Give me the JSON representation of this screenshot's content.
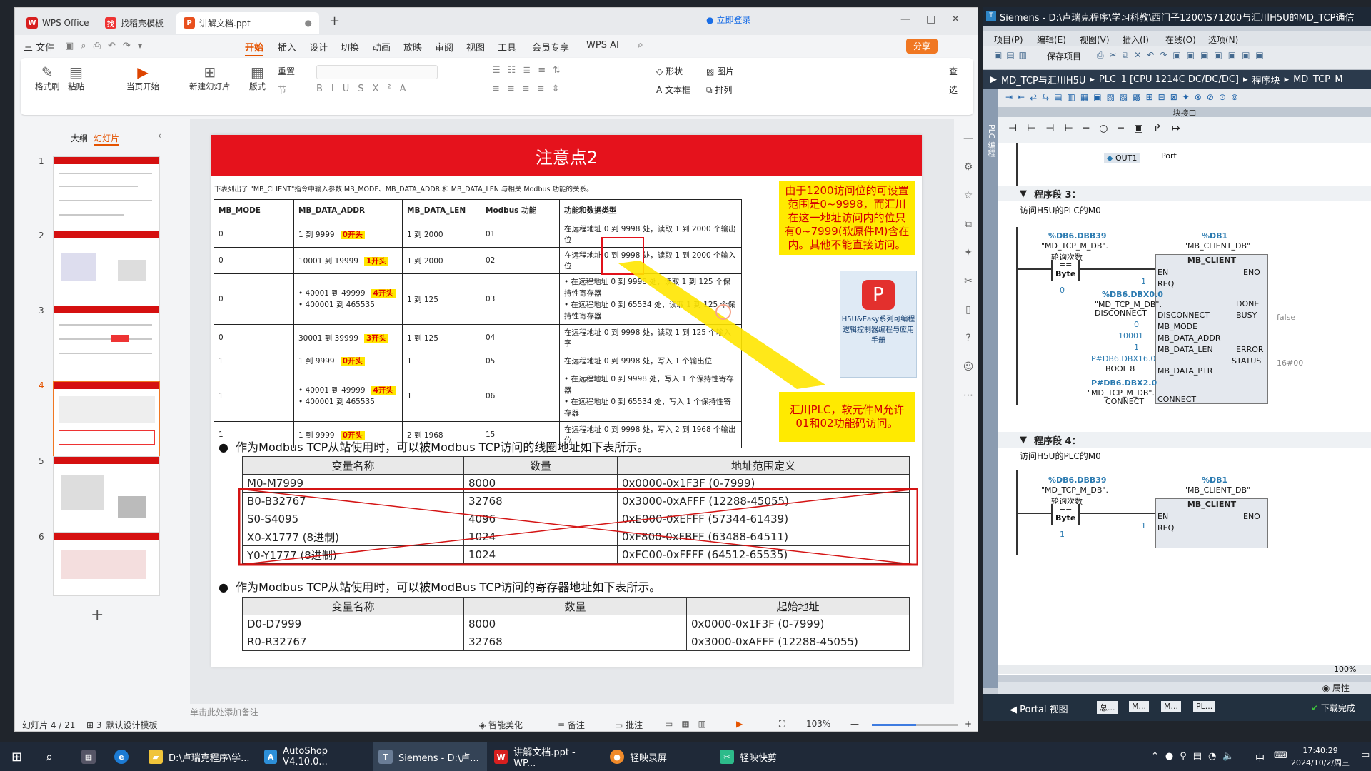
{
  "wps": {
    "tabs": [
      "WPS Office",
      "找稻壳模板",
      "讲解文档.ppt"
    ],
    "login": "立即登录",
    "share": "分享",
    "menu": [
      "三 文件",
      "开始",
      "插入",
      "设计",
      "切换",
      "动画",
      "放映",
      "审阅",
      "视图",
      "工具",
      "会员专享",
      "WPS AI"
    ],
    "ribbon": {
      "format_brush": "格式刷",
      "paste": "粘贴",
      "from_current": "当页开始",
      "new_slide": "新建幻灯片",
      "layout": "版式",
      "reset": "重置",
      "section": "节",
      "shape": "形状",
      "picture": "图片",
      "textbox": "文本框",
      "arrange": "排列",
      "find": "查",
      "select": "选"
    },
    "panel": {
      "outline": "大纲",
      "slides": "幻灯片",
      "nums": [
        "1",
        "2",
        "3",
        "4",
        "5",
        "6"
      ]
    },
    "slide": {
      "title": "注意点2",
      "intro": "下表列出了 \"MB_CLIENT\"指令中输入参数 MB_MODE、MB_DATA_ADDR 和 MB_DATA_LEN 与相关 Modbus 功能的关系。",
      "t1_headers": [
        "MB_MODE",
        "MB_DATA_ADDR",
        "MB_DATA_LEN",
        "Modbus 功能",
        "功能和数据类型"
      ],
      "t1_rows": [
        {
          "mode": "0",
          "addr": "1 到 9999",
          "tag": "0开头",
          "len": "1 到 2000",
          "fn": "01",
          "desc": "在远程地址 0 到 9998 处，读取 1 到 2000 个输出位"
        },
        {
          "mode": "0",
          "addr": "10001 到 19999",
          "tag": "1开头",
          "len": "1 到 2000",
          "fn": "02",
          "desc": "在远程地址 0 到 9998 处，读取 1 到 2000 个输入位"
        },
        {
          "mode": "0",
          "addr": "40001 到 49999",
          "addr2": "400001 到 465535",
          "tag": "4开头",
          "len": "1 到 125",
          "fn": "03",
          "desc": "在远程地址 0 到 9998 处，读取 1 到 125 个保持性寄存器",
          "desc2": "在远程地址 0 到 65534 处，读取 1 到 125 个保持性寄存器"
        },
        {
          "mode": "0",
          "addr": "30001 到 39999",
          "tag": "3开头",
          "len": "1 到 125",
          "fn": "04",
          "desc": "在远程地址 0 到 9998 处，读取 1 到 125 个输入字"
        },
        {
          "mode": "1",
          "addr": "1 到 9999",
          "tag": "0开头",
          "len": "1",
          "fn": "05",
          "desc": "在远程地址 0 到 9998 处，写入 1 个输出位"
        },
        {
          "mode": "1",
          "addr": "40001 到 49999",
          "addr2": "400001 到 465535",
          "tag": "4开头",
          "len": "1",
          "fn": "06",
          "desc": "在远程地址 0 到 9998 处，写入 1 个保持性寄存器",
          "desc2": "在远程地址 0 到 65534 处，写入 1 个保持性寄存器"
        },
        {
          "mode": "1",
          "addr": "1 到 9999",
          "tag": "0开头",
          "len": "2 到 1968",
          "fn": "15",
          "desc": "在远程地址 0 到 9998 处，写入 2 到 1968 个输出位"
        }
      ],
      "note1": "由于1200访问位的可设置范围是0~9998，而汇川在这一地址访问内的位只有0~7999(软原件M)含在内。其他不能直接访问。",
      "note2": "汇川PLC，软元件M允许01和02功能码访问。",
      "book": "H5U&Easy系列可编程逻辑控制器编程与应用手册",
      "bullet1": "作为Modbus TCP从站使用时，可以被Modbus TCP访问的线圈地址如下表所示。",
      "t2_headers": [
        "变量名称",
        "数量",
        "地址范围定义"
      ],
      "t2_rows": [
        [
          "M0-M7999",
          "8000",
          "0x0000-0x1F3F (0-7999)"
        ],
        [
          "B0-B32767",
          "32768",
          "0x3000-0xAFFF (12288-45055)"
        ],
        [
          "S0-S4095",
          "4096",
          "0xE000-0xEFFF (57344-61439)"
        ],
        [
          "X0-X1777 (8进制)",
          "1024",
          "0xF800-0xFBFF (63488-64511)"
        ],
        [
          "Y0-Y1777 (8进制)",
          "1024",
          "0xFC00-0xFFFF (64512-65535)"
        ]
      ],
      "bullet2": "作为Modbus TCP从站使用时，可以被ModBus TCP访问的寄存器地址如下表所示。",
      "t3_headers": [
        "变量名称",
        "数量",
        "起始地址"
      ],
      "t3_rows": [
        [
          "D0-D7999",
          "8000",
          "0x0000-0x1F3F (0-7999)"
        ],
        [
          "R0-R32767",
          "32768",
          "0x3000-0xAFFF (12288-45055)"
        ]
      ]
    },
    "notes_placeholder": "单击此处添加备注",
    "status": {
      "slide": "幻灯片 4 / 21",
      "template": "3_默认设计模板",
      "beautify": "智能美化",
      "remark": "备注",
      "comment": "批注",
      "zoom": "103%"
    }
  },
  "siemens": {
    "title": "Siemens  -  D:\\卢瑞克程序\\学习科教\\西门子1200\\S71200与汇川H5U的MD_TCP通信",
    "menu": [
      "项目(P)",
      "编辑(E)",
      "视图(V)",
      "插入(I)",
      "在线(O)",
      "选项(N)"
    ],
    "save": "保存项目",
    "breadcrumb": [
      "MD_TCP与汇川H5U",
      "PLC_1 [CPU 1214C DC/DC/DC]",
      "程序块",
      "MD_TCP_M"
    ],
    "block_interface": "块接口",
    "side_label": "PLC 编程",
    "out1": "OUT1",
    "port": "Port",
    "seg3": {
      "label": "程序段 3：",
      "comment": "访问H5U的PLC的M0"
    },
    "seg4": {
      "label": "程序段 4：",
      "comment": "访问H5U的PLC的M0"
    },
    "tag_dbb39": "%DB6.DBB39",
    "tag_mdb": "\"MD_TCP_M_DB\".",
    "tag_poll": "轮询次数",
    "cmp": "==",
    "byte": "Byte",
    "val0": "0",
    "val1": "1",
    "db1": "%DB1",
    "client_db": "\"MB_CLIENT_DB\"",
    "fb": "MB_CLIENT",
    "pins": {
      "en": "EN",
      "eno": "ENO",
      "req": "REQ",
      "disc": "DISCONNECT",
      "mode": "MB_MODE",
      "addr": "MB_DATA_ADDR",
      "len": "MB_DATA_LEN",
      "ptr": "MB_DATA_PTR",
      "conn": "CONNECT",
      "done": "DONE",
      "busy": "BUSY",
      "err": "ERROR",
      "st": "STATUS"
    },
    "in_vals": {
      "req": "1",
      "mode": "0",
      "addr": "10001",
      "len": "1"
    },
    "dbx00": "%DB6.DBX0.0",
    "disc_label": "DISCONNECT",
    "ptr_tag": "P#DB6.DBX16.0",
    "ptr_type": "BOOL 8",
    "conn_tag": "P#DB6.DBX2.0",
    "conn_label": "CONNECT",
    "false": "false",
    "status_val": "16#00",
    "zoom": "100%",
    "props": "属性",
    "portal": "Portal 视图",
    "foot_tabs": [
      "总...",
      "M...",
      "M...",
      "PL..."
    ],
    "download": "下载完成"
  },
  "taskbar": {
    "items": [
      "D:\\卢瑞克程序\\学...",
      "AutoShop V4.10.0...",
      "Siemens  -  D:\\卢...",
      "讲解文档.ppt - WP...",
      "轻映录屏",
      "轻映快剪"
    ],
    "ime": "中",
    "time": "17:40:29",
    "date": "2024/10/2/周三"
  }
}
